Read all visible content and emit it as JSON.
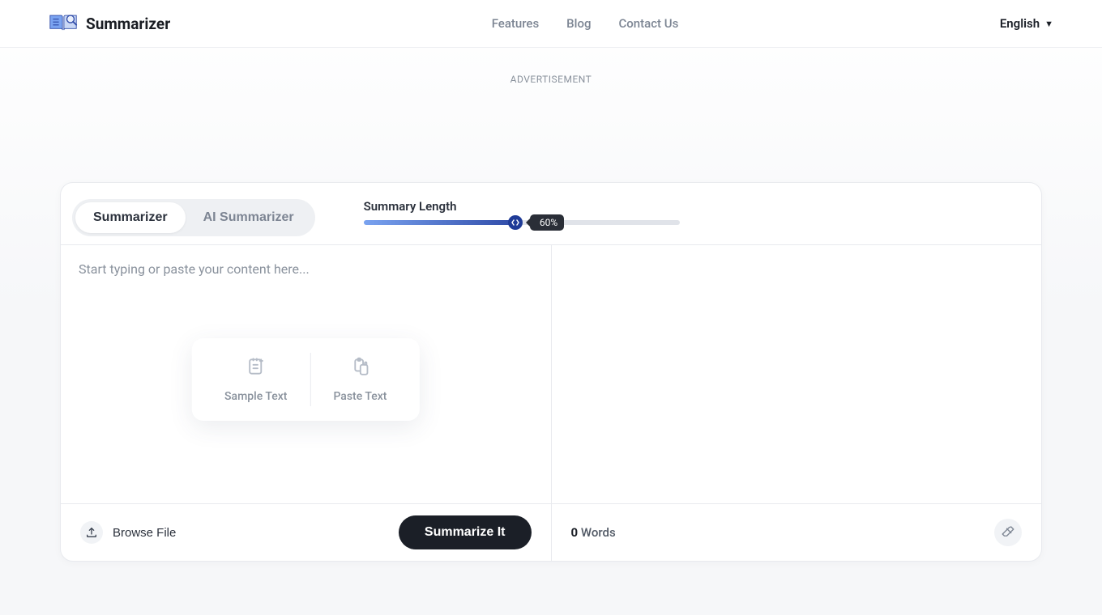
{
  "header": {
    "brand": "Summarizer",
    "nav": {
      "features": "Features",
      "blog": "Blog",
      "contact": "Contact Us"
    },
    "language": "English"
  },
  "ad_label": "ADVERTISEMENT",
  "tabs": {
    "summarizer": "Summarizer",
    "ai_summarizer": "AI Summarizer",
    "active": "summarizer"
  },
  "slider": {
    "label": "Summary Length",
    "value_pct": 60,
    "value_label": "60%"
  },
  "editor": {
    "placeholder": "Start typing or paste your content here...",
    "helper": {
      "sample": "Sample Text",
      "paste": "Paste Text"
    }
  },
  "footer": {
    "browse": "Browse File",
    "summarize": "Summarize It",
    "word_count_value": "0",
    "word_count_label": "Words"
  }
}
